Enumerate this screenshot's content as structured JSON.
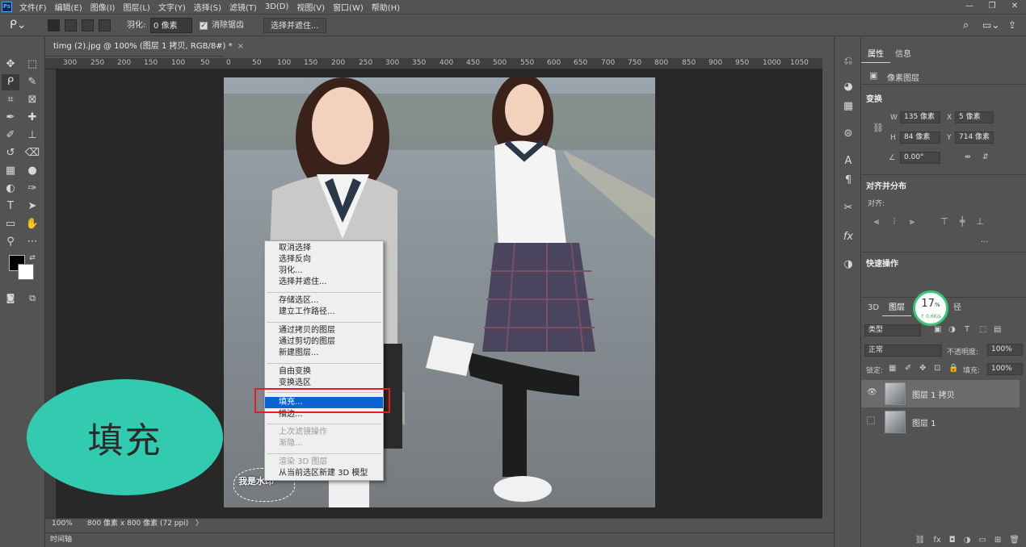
{
  "app": {
    "logo": "Ps"
  },
  "menu": [
    "文件(F)",
    "编辑(E)",
    "图像(I)",
    "图层(L)",
    "文字(Y)",
    "选择(S)",
    "滤镜(T)",
    "3D(D)",
    "视图(V)",
    "窗口(W)",
    "帮助(H)"
  ],
  "options": {
    "feather_label": "羽化:",
    "feather_value": "0 像素",
    "antialias_label": "消除锯齿",
    "select_mask_button": "选择并遮住..."
  },
  "document": {
    "tab_title": "timg (2).jpg @ 100% (图层 1 拷贝, RGB/8#) *",
    "tab_close": "×"
  },
  "ruler": [
    "300",
    "250",
    "200",
    "150",
    "100",
    "50",
    "0",
    "50",
    "100",
    "150",
    "200",
    "250",
    "300",
    "350",
    "400",
    "450",
    "500",
    "550",
    "600",
    "650",
    "700",
    "750",
    "800",
    "850",
    "900",
    "950",
    "1000",
    "1050"
  ],
  "status": {
    "zoom": "100%",
    "doc_size": "800 像素 x 800 像素 (72 ppi)",
    "arrow": "〉"
  },
  "timeline": {
    "label": "时间轴"
  },
  "context_menu": {
    "items": [
      {
        "label": "取消选择",
        "enabled": true
      },
      {
        "label": "选择反向",
        "enabled": true
      },
      {
        "label": "羽化...",
        "enabled": true
      },
      {
        "label": "选择并遮住...",
        "enabled": true
      },
      {
        "label": "存储选区...",
        "enabled": true
      },
      {
        "label": "建立工作路径...",
        "enabled": true
      },
      {
        "label": "通过拷贝的图层",
        "enabled": true
      },
      {
        "label": "通过剪切的图层",
        "enabled": true
      },
      {
        "label": "新建图层...",
        "enabled": true
      },
      {
        "label": "自由变换",
        "enabled": true
      },
      {
        "label": "变换选区",
        "enabled": true
      },
      {
        "label": "填充...",
        "enabled": true,
        "highlighted": true
      },
      {
        "label": "描边...",
        "enabled": true
      },
      {
        "label": "上次滤镜操作",
        "enabled": false
      },
      {
        "label": "渐隐...",
        "enabled": false
      },
      {
        "label": "渲染 3D 图层",
        "enabled": false
      },
      {
        "label": "从当前选区新建 3D 模型",
        "enabled": true
      }
    ]
  },
  "overlay": {
    "callout_text": "填充",
    "watermark_text": "我是水印"
  },
  "properties": {
    "tabs": [
      "属性",
      "信息"
    ],
    "type_label": "像素图层",
    "transform_title": "变换",
    "w_label": "W",
    "w_value": "135 像素",
    "x_label": "X",
    "x_value": "5 像素",
    "h_label": "H",
    "h_value": "84 像素",
    "y_label": "Y",
    "y_value": "714 像素",
    "angle_value": "0.00°",
    "align_title": "对齐并分布",
    "align_label": "对齐:",
    "more": "...",
    "quick_title": "快速操作"
  },
  "gauge": {
    "percent": "17",
    "unit": "%",
    "rate": "↑ 0.6K/s"
  },
  "layers": {
    "tabs": [
      "3D",
      "图层",
      "径"
    ],
    "filter_kind": "类型",
    "blend_mode": "正常",
    "opacity_label": "不透明度:",
    "opacity_value": "100%",
    "lock_label": "锁定:",
    "fill_label": "填充:",
    "fill_value": "100%",
    "items": [
      {
        "name": "图层 1 拷贝",
        "visible": true,
        "selected": true
      },
      {
        "name": "图层 1",
        "visible": false,
        "selected": false
      }
    ]
  },
  "colors": {
    "accent": "#0a64d4",
    "callout": "#33cbb0",
    "highlight_box": "#e02020"
  }
}
